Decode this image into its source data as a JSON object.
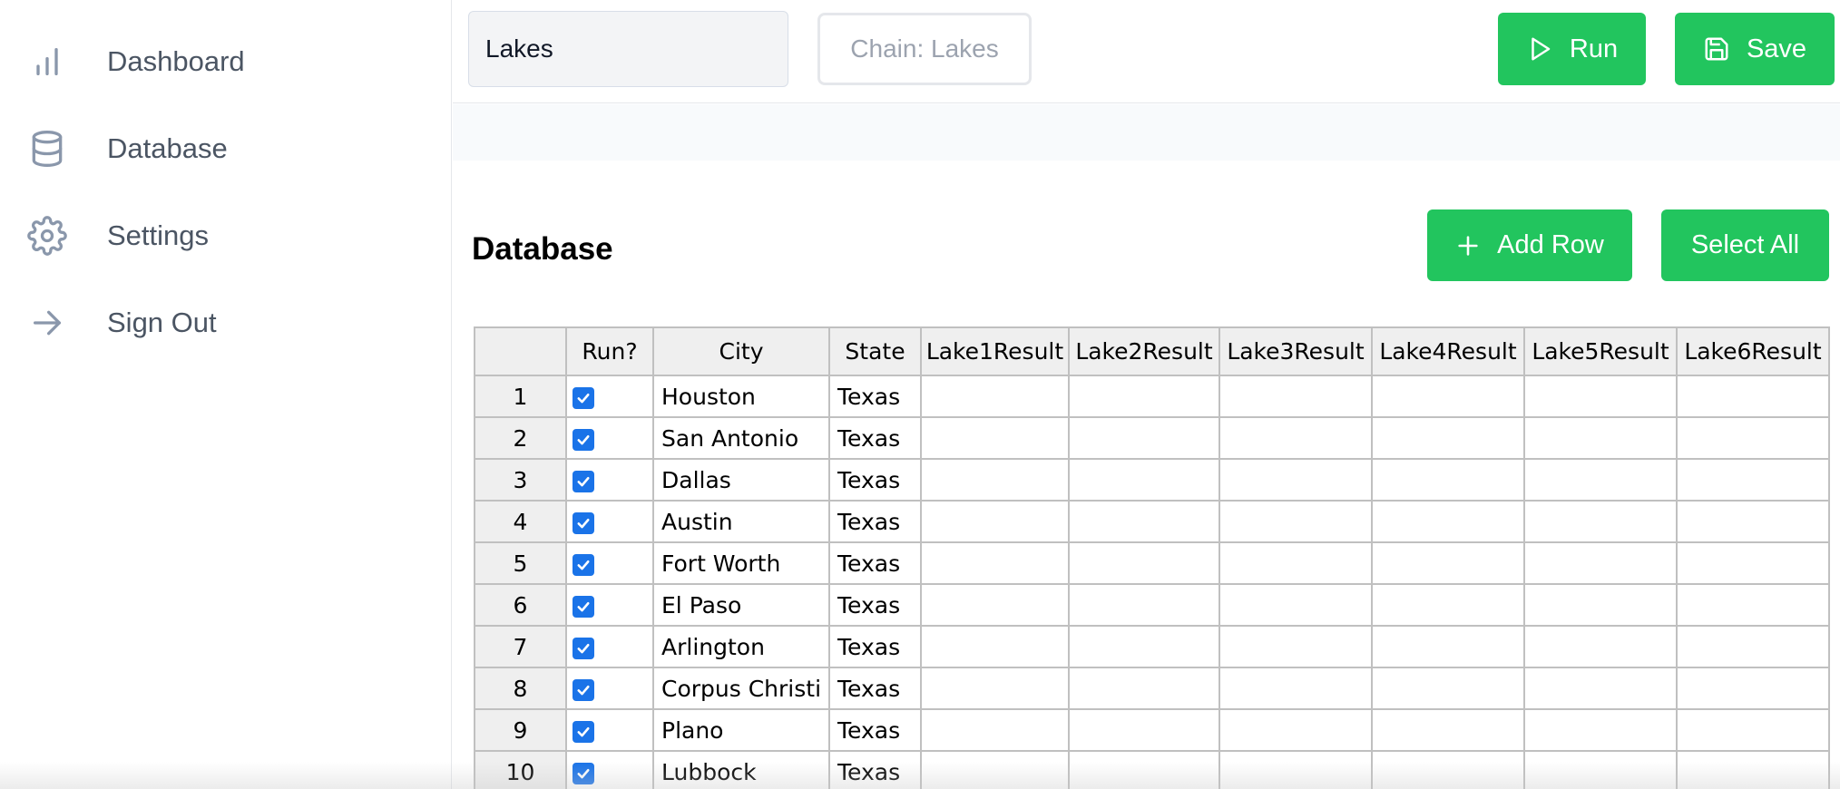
{
  "sidebar": {
    "items": [
      {
        "label": "Dashboard",
        "icon": "bar-chart-icon"
      },
      {
        "label": "Database",
        "icon": "database-icon"
      },
      {
        "label": "Settings",
        "icon": "gear-icon"
      },
      {
        "label": "Sign Out",
        "icon": "arrow-right-icon"
      }
    ]
  },
  "toolbar": {
    "name_value": "Lakes",
    "chain_label": "Chain: Lakes",
    "run_label": "Run",
    "save_label": "Save"
  },
  "database": {
    "title": "Database",
    "add_row_label": "Add Row",
    "select_all_label": "Select All"
  },
  "table": {
    "headers": [
      "",
      "Run?",
      "City",
      "State",
      "Lake1Result",
      "Lake2Result",
      "Lake3Result",
      "Lake4Result",
      "Lake5Result",
      "Lake6Result"
    ],
    "rows": [
      {
        "num": "1",
        "run": true,
        "city": "Houston",
        "state": "Texas"
      },
      {
        "num": "2",
        "run": true,
        "city": "San Antonio",
        "state": "Texas"
      },
      {
        "num": "3",
        "run": true,
        "city": "Dallas",
        "state": "Texas"
      },
      {
        "num": "4",
        "run": true,
        "city": "Austin",
        "state": "Texas"
      },
      {
        "num": "5",
        "run": true,
        "city": "Fort Worth",
        "state": "Texas"
      },
      {
        "num": "6",
        "run": true,
        "city": "El Paso",
        "state": "Texas"
      },
      {
        "num": "7",
        "run": true,
        "city": "Arlington",
        "state": "Texas"
      },
      {
        "num": "8",
        "run": true,
        "city": "Corpus Christi",
        "state": "Texas"
      },
      {
        "num": "9",
        "run": true,
        "city": "Plano",
        "state": "Texas"
      },
      {
        "num": "10",
        "run": true,
        "city": "Lubbock",
        "state": "Texas"
      }
    ]
  },
  "colors": {
    "accent_green": "#22c55e",
    "checkbox_blue": "#1a73e8",
    "sidebar_text": "#4b5563",
    "icon_gray": "#8a97ab"
  }
}
